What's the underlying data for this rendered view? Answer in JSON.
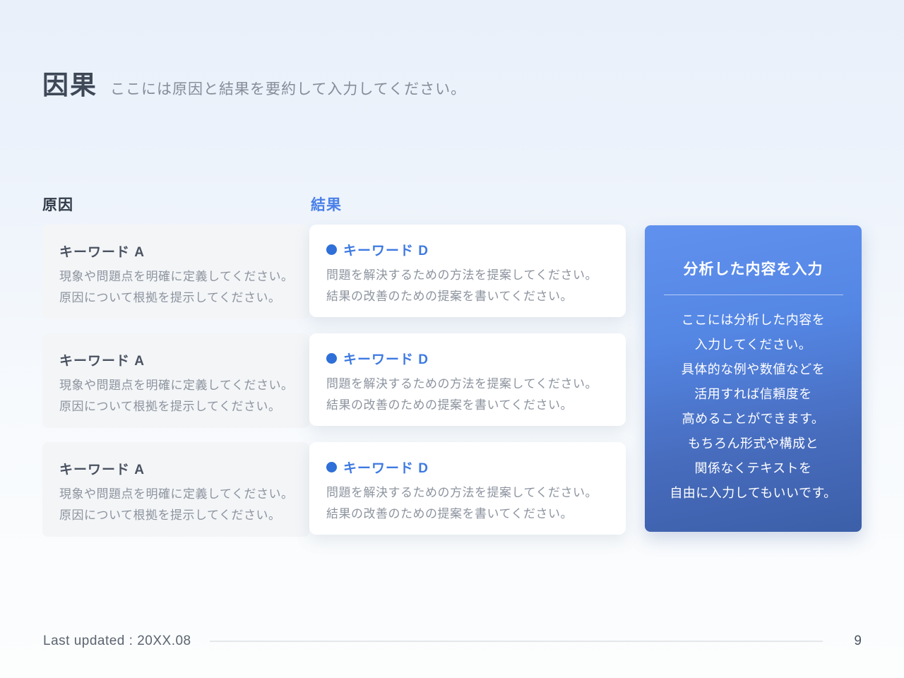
{
  "header": {
    "title": "因果",
    "subtitle": "ここには原因と結果を要約して入力してください。"
  },
  "table": {
    "cause_header": "原因",
    "effect_header": "結果",
    "rows": [
      {
        "cause": {
          "keyword": "キーワード A",
          "line1": "現象や問題点を明確に定義してください。",
          "line2": "原因について根拠を提示してください。"
        },
        "effect": {
          "keyword": "キーワード D",
          "line1": "問題を解決するための方法を提案してください。",
          "line2": "結果の改善のための提案を書いてください。"
        }
      },
      {
        "cause": {
          "keyword": "キーワード A",
          "line1": "現象や問題点を明確に定義してください。",
          "line2": "原因について根拠を提示してください。"
        },
        "effect": {
          "keyword": "キーワード D",
          "line1": "問題を解決するための方法を提案してください。",
          "line2": "結果の改善のための提案を書いてください。"
        }
      },
      {
        "cause": {
          "keyword": "キーワード A",
          "line1": "現象や問題点を明確に定義してください。",
          "line2": "原因について根拠を提示してください。"
        },
        "effect": {
          "keyword": "キーワード D",
          "line1": "問題を解決するための方法を提案してください。",
          "line2": "結果の改善のための提案を書いてください。"
        }
      }
    ]
  },
  "panel": {
    "title": "分析した内容を入力",
    "lines": [
      "ここには分析した内容を",
      "入力してください。",
      "具体的な例や数値などを",
      "活用すれば信頼度を",
      "高めることができます。",
      "もちろん形式や構成と",
      "関係なくテキストを",
      "自由に入力してもいいです。"
    ]
  },
  "footer": {
    "last_updated": "Last updated : 20XX.08",
    "page_number": "9"
  },
  "colors": {
    "accent_blue": "#4a80e8",
    "bullet_dot": "#2e6fd8",
    "panel_gradient_top": "#6191ef",
    "panel_gradient_bottom": "#3c5fa8",
    "cause_card_bg": "#f3f5f7"
  }
}
